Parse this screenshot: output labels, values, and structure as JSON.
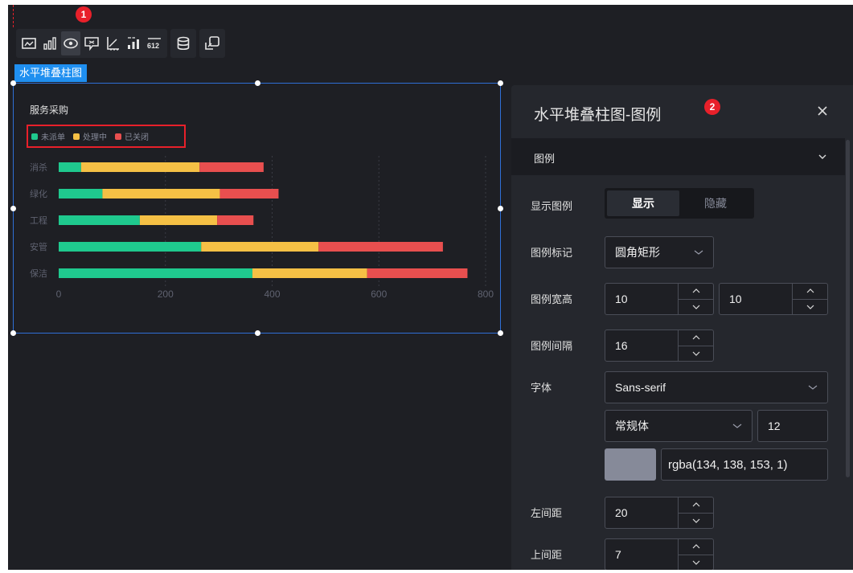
{
  "toolbar": {
    "groups": [
      [
        "image-icon",
        "bar-chart-icon",
        "eye-icon",
        "tooltip-icon",
        "axis-icon",
        "data-label-icon",
        "number-icon"
      ],
      [
        "database-icon"
      ],
      [
        "interaction-icon"
      ]
    ],
    "number_icon_text": "612",
    "badge": "1"
  },
  "component": {
    "label": "水平堆叠柱图"
  },
  "chart_data": {
    "type": "bar",
    "orientation": "horizontal",
    "stacked": true,
    "title": "服务采购",
    "categories": [
      "消杀",
      "绿化",
      "工程",
      "安管",
      "保洁"
    ],
    "series": [
      {
        "name": "未派单",
        "color": "#1fc98e",
        "values": [
          42,
          82,
          152,
          267,
          363
        ]
      },
      {
        "name": "处理中",
        "color": "#f5c045",
        "values": [
          222,
          220,
          145,
          220,
          215
        ]
      },
      {
        "name": "已关闭",
        "color": "#e84f4f",
        "values": [
          120,
          110,
          68,
          233,
          188
        ]
      }
    ],
    "xlim": [
      0,
      800
    ],
    "xticks": [
      "0",
      "200",
      "400",
      "600",
      "800"
    ],
    "grid": true,
    "legend_position": "top-left"
  },
  "panel": {
    "title": "水平堆叠柱图-图例",
    "badge": "2",
    "section": "图例",
    "show_legend": {
      "label": "显示图例",
      "on": "显示",
      "off": "隐藏"
    },
    "legend_marker": {
      "label": "图例标记",
      "value": "圆角矩形"
    },
    "legend_size": {
      "label": "图例宽高",
      "width": "10",
      "height": "10"
    },
    "legend_gap": {
      "label": "图例间隔",
      "value": "16"
    },
    "font": {
      "label": "字体",
      "family": "Sans-serif",
      "weight": "常规体",
      "size": "12",
      "color": "rgba(134, 138, 153, 1)",
      "swatch": "#868a99"
    },
    "left_margin": {
      "label": "左间距",
      "value": "20"
    },
    "top_margin": {
      "label": "上间距",
      "value": "7"
    }
  }
}
